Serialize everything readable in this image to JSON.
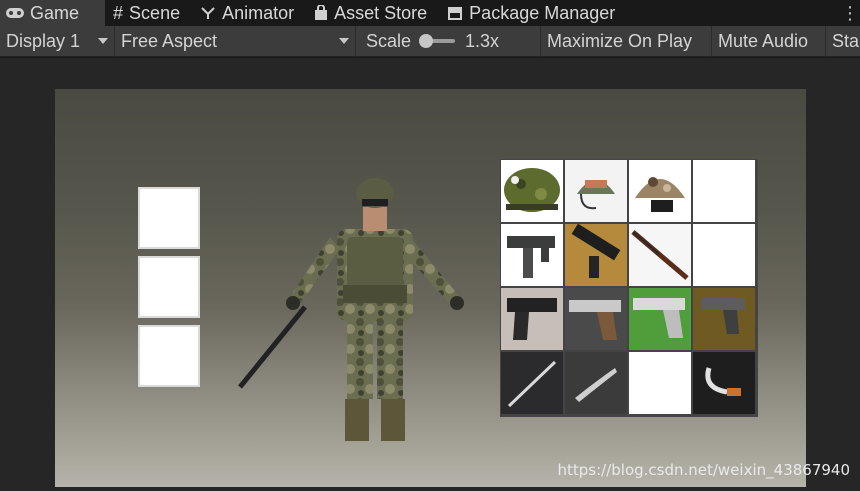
{
  "tabs": [
    {
      "label": "Game",
      "icon": "gamepad-icon",
      "active": true
    },
    {
      "label": "Scene",
      "icon": "grid-icon",
      "active": false
    },
    {
      "label": "Animator",
      "icon": "animator-icon",
      "active": false
    },
    {
      "label": "Asset Store",
      "icon": "shopping-bag-icon",
      "active": false
    },
    {
      "label": "Package Manager",
      "icon": "package-icon",
      "active": false
    }
  ],
  "toolbar": {
    "display": "Display 1",
    "aspect": "Free Aspect",
    "scale_label": "Scale",
    "scale_value": "1.3x",
    "maximize_on_play": "Maximize On Play",
    "mute_audio": "Mute Audio",
    "stats": "Sta"
  },
  "game": {
    "equipment_slots": [
      "empty",
      "empty",
      "empty"
    ],
    "inventory": [
      [
        "camo-helmet",
        "green-helmet",
        "desert-helmet",
        "empty"
      ],
      [
        "uzi-smg",
        "mp5-smg",
        "rifle",
        "empty"
      ],
      [
        "pistol-black",
        "pistol-silver",
        "pistol-green-bg",
        "pistol-small"
      ],
      [
        "combat-knife",
        "kukri-knife",
        "empty",
        "karambit-knife"
      ]
    ]
  },
  "watermark": "https://blog.csdn.net/weixin_43867940",
  "colors": {
    "tab_active_bg": "#3c3c3c",
    "toolbar_bg": "#3c3c3c",
    "slot_bg": "#ffffff"
  }
}
